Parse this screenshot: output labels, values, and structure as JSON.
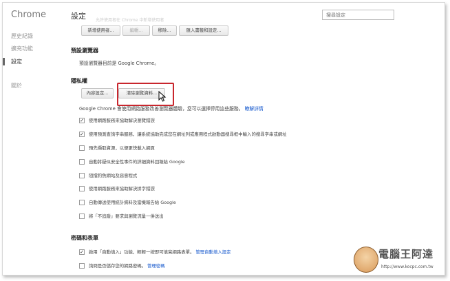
{
  "app_title": "Chrome",
  "sidebar": {
    "items": [
      {
        "label": "歷史紀錄"
      },
      {
        "label": "擴充功能"
      },
      {
        "label": "設定"
      },
      {
        "label": "關於"
      }
    ]
  },
  "header": {
    "title": "設定",
    "search_placeholder": "搜尋設定",
    "faded_text": "允許使用者在 Chrome 中新增使用者"
  },
  "users": {
    "buttons": {
      "add": "新增使用者...",
      "edit": "編輯...",
      "remove": "移除...",
      "import": "匯入書籤和設定..."
    }
  },
  "default_browser": {
    "title": "預設瀏覽器",
    "text": "預設瀏覽器目前是 Google Chrome。"
  },
  "privacy": {
    "title": "隱私權",
    "content_settings_button": "內容設定...",
    "clear_data_button": "清除瀏覽資料...",
    "description": "Google Chrome 會使用網路服務改善瀏覽器體驗，您可以選擇停用這些服務。",
    "learn_more": "瞭解詳情",
    "options": [
      {
        "label": "使用網路服務來協助解決瀏覽錯誤",
        "checked": true
      },
      {
        "label": "使用預測查詢字串服務，讓系統協助完成您在網址列或應用程式啟動器搜尋框中輸入的搜尋字串或網址",
        "checked": true
      },
      {
        "label": "預先擷取資源，以便更快載入網頁",
        "checked": false
      },
      {
        "label": "自動將疑似安全性事件的詳細資料回報給 Google",
        "checked": false
      },
      {
        "label": "阻擋釣魚網站及惡意程式",
        "checked": false
      },
      {
        "label": "使用網路服務來協助解決拼字錯誤",
        "checked": false
      },
      {
        "label": "自動傳送使用統計資料及當機報告給 Google",
        "checked": false
      },
      {
        "label": "將「不追蹤」要求與瀏覽流量一併送出",
        "checked": false
      }
    ]
  },
  "passwords": {
    "title": "密碼和表單",
    "autofill_label": "啟用「自動填入」功能，輕輕一按即可填寫網路表單。",
    "autofill_link": "管理自動填入設定",
    "autofill_checked": true,
    "save_passwords_label": "詢問是否儲存您的網路密碼。",
    "save_passwords_link": "管理密碼",
    "save_passwords_checked": false
  },
  "watermark": {
    "brand": "電腦王阿達",
    "url": "http://www.kocpc.com.tw"
  }
}
